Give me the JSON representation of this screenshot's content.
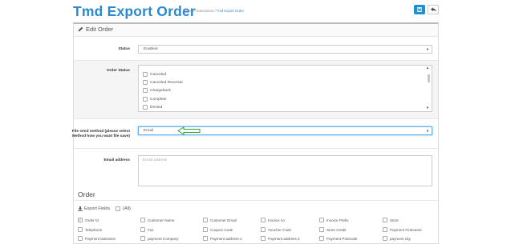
{
  "header": {
    "title": "Tmd Export Order",
    "breadcrumb": [
      "Home",
      "Extensions",
      "Tmd Export Order"
    ],
    "breadcrumb_sep": "/"
  },
  "panel": {
    "title": "Edit Order"
  },
  "status": {
    "label": "Status",
    "value": "Enabled"
  },
  "order_status": {
    "label": "Order Status",
    "options": [
      "Canceled",
      "Canceled Reversal",
      "Chargeback",
      "Complete",
      "Denied"
    ]
  },
  "file_send": {
    "label": "File send method (please select Method how you want file save)",
    "value": "Email"
  },
  "email": {
    "label": "Email address",
    "placeholder": "Email address"
  },
  "order_section": {
    "title": "Order"
  },
  "export_fields": {
    "label": "Export Fields",
    "all_label": "(All)"
  },
  "fields": [
    [
      "Order Id",
      "Customer Name",
      "Customer Email",
      "Invoice no",
      "Invoice Prefix",
      "Store"
    ],
    [
      "Telephone",
      "Fax",
      "Coupon Code",
      "Voucher Code",
      "Store Credit",
      "Payment Firstname"
    ],
    [
      "Payment lastname",
      "payment Company",
      "Payment address 1",
      "Payment address 2",
      "Payment Postcode",
      "payment city"
    ]
  ],
  "checked_fields": [
    "Order Id"
  ],
  "colors": {
    "accent": "#2a8ad0",
    "arrow": "#2ca02c"
  },
  "icons": {
    "save": "save-icon",
    "back": "reply-icon",
    "edit": "pencil-icon",
    "export": "download-icon"
  }
}
